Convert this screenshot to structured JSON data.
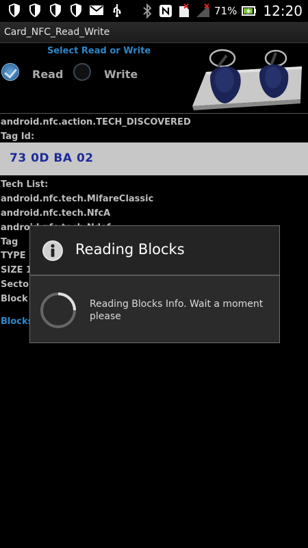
{
  "status_bar": {
    "left_icons": [
      "shield-icon",
      "shield-icon",
      "shield-icon",
      "shield-icon",
      "mail-icon",
      "usb-icon"
    ],
    "right_icons": [
      "bluetooth-icon",
      "nfc-icon",
      "sim-missing-icon",
      "signal-icon"
    ],
    "battery_percent": "71%",
    "time": "12:20"
  },
  "app": {
    "title": "Card_NFC_Read_Write"
  },
  "mode": {
    "prompt": "Select Read or Write",
    "read_label": "Read",
    "write_label": "Write",
    "selected": "Read"
  },
  "info": {
    "action": "android.nfc.action.TECH_DISCOVERED",
    "tag_id_label": "Tag Id:",
    "tag_id_value": "73 0D BA 02",
    "tech_list_label": "Tech List:",
    "tech_items": [
      "android.nfc.tech.MifareClassic",
      "android.nfc.tech.NfcA",
      "android.nfc.tech.Ndef"
    ],
    "tag_label": "Tag",
    "type_label": "TYPE C",
    "size_label": "SIZE 1",
    "sector_label": "Sector",
    "block_label": "Block",
    "blocks_link": "Blocks"
  },
  "dialog": {
    "title": "Reading Blocks",
    "message": "Reading Blocks Info. Wait a moment please"
  },
  "colors": {
    "accent": "#2f86c9",
    "tag_value": "#1d2b9a",
    "background": "#000000"
  }
}
